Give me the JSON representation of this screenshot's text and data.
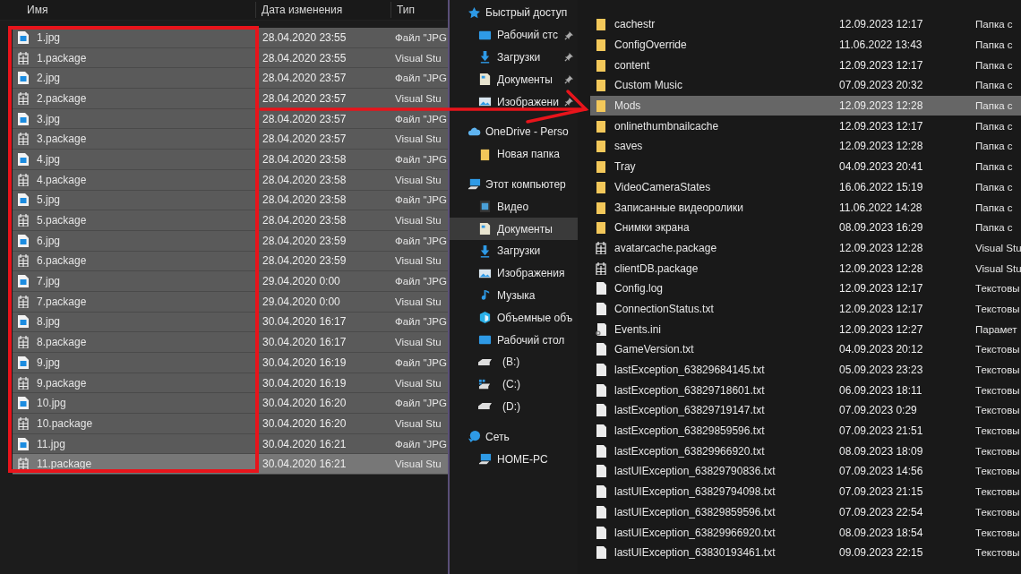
{
  "left_pane": {
    "columns": [
      "Имя",
      "Дата изменения",
      "Тип"
    ],
    "rows": [
      {
        "name": "1.jpg",
        "kind": "image",
        "date": "28.04.2020 23:55",
        "type": "Файл \"JPG",
        "selected": true,
        "hovered": false
      },
      {
        "name": "1.package",
        "kind": "package",
        "date": "28.04.2020 23:55",
        "type": "Visual Stu",
        "selected": true,
        "hovered": false
      },
      {
        "name": "2.jpg",
        "kind": "image",
        "date": "28.04.2020 23:57",
        "type": "Файл \"JPG",
        "selected": true,
        "hovered": false
      },
      {
        "name": "2.package",
        "kind": "package",
        "date": "28.04.2020 23:57",
        "type": "Visual Stu",
        "selected": true,
        "hovered": false
      },
      {
        "name": "3.jpg",
        "kind": "image",
        "date": "28.04.2020 23:57",
        "type": "Файл \"JPG",
        "selected": true,
        "hovered": false
      },
      {
        "name": "3.package",
        "kind": "package",
        "date": "28.04.2020 23:57",
        "type": "Visual Stu",
        "selected": true,
        "hovered": false
      },
      {
        "name": "4.jpg",
        "kind": "image",
        "date": "28.04.2020 23:58",
        "type": "Файл \"JPG",
        "selected": true,
        "hovered": false
      },
      {
        "name": "4.package",
        "kind": "package",
        "date": "28.04.2020 23:58",
        "type": "Visual Stu",
        "selected": true,
        "hovered": false
      },
      {
        "name": "5.jpg",
        "kind": "image",
        "date": "28.04.2020 23:58",
        "type": "Файл \"JPG",
        "selected": true,
        "hovered": false
      },
      {
        "name": "5.package",
        "kind": "package",
        "date": "28.04.2020 23:58",
        "type": "Visual Stu",
        "selected": true,
        "hovered": false
      },
      {
        "name": "6.jpg",
        "kind": "image",
        "date": "28.04.2020 23:59",
        "type": "Файл \"JPG",
        "selected": true,
        "hovered": false
      },
      {
        "name": "6.package",
        "kind": "package",
        "date": "28.04.2020 23:59",
        "type": "Visual Stu",
        "selected": true,
        "hovered": false
      },
      {
        "name": "7.jpg",
        "kind": "image",
        "date": "29.04.2020 0:00",
        "type": "Файл \"JPG",
        "selected": true,
        "hovered": false
      },
      {
        "name": "7.package",
        "kind": "package",
        "date": "29.04.2020 0:00",
        "type": "Visual Stu",
        "selected": true,
        "hovered": false
      },
      {
        "name": "8.jpg",
        "kind": "image",
        "date": "30.04.2020 16:17",
        "type": "Файл \"JPG",
        "selected": true,
        "hovered": false
      },
      {
        "name": "8.package",
        "kind": "package",
        "date": "30.04.2020 16:17",
        "type": "Visual Stu",
        "selected": true,
        "hovered": false
      },
      {
        "name": "9.jpg",
        "kind": "image",
        "date": "30.04.2020 16:19",
        "type": "Файл \"JPG",
        "selected": true,
        "hovered": false
      },
      {
        "name": "9.package",
        "kind": "package",
        "date": "30.04.2020 16:19",
        "type": "Visual Stu",
        "selected": true,
        "hovered": false
      },
      {
        "name": "10.jpg",
        "kind": "image",
        "date": "30.04.2020 16:20",
        "type": "Файл \"JPG",
        "selected": true,
        "hovered": false
      },
      {
        "name": "10.package",
        "kind": "package",
        "date": "30.04.2020 16:20",
        "type": "Visual Stu",
        "selected": true,
        "hovered": false
      },
      {
        "name": "11.jpg",
        "kind": "image",
        "date": "30.04.2020 16:21",
        "type": "Файл \"JPG",
        "selected": true,
        "hovered": false
      },
      {
        "name": "11.package",
        "kind": "package",
        "date": "30.04.2020 16:21",
        "type": "Visual Stu",
        "selected": true,
        "hovered": true
      }
    ]
  },
  "navigation": [
    {
      "label": "Быстрый доступ",
      "kind": "star",
      "selected": false,
      "pinned": false,
      "children": [
        {
          "label": "Рабочий стс",
          "kind": "desktop",
          "selected": false,
          "pinned": true
        },
        {
          "label": "Загрузки",
          "kind": "download",
          "selected": false,
          "pinned": true
        },
        {
          "label": "Документы",
          "kind": "document",
          "selected": false,
          "pinned": true
        },
        {
          "label": "Изображени",
          "kind": "image",
          "selected": false,
          "pinned": true
        }
      ]
    },
    {
      "label": "OneDrive - Perso",
      "kind": "cloud",
      "selected": false,
      "pinned": false,
      "children": [
        {
          "label": "Новая папка",
          "kind": "folder",
          "selected": false,
          "pinned": false
        }
      ]
    },
    {
      "label": "Этот компьютер",
      "kind": "computer",
      "selected": false,
      "pinned": false,
      "children": [
        {
          "label": "Видео",
          "kind": "video",
          "selected": false,
          "pinned": false
        },
        {
          "label": "Документы",
          "kind": "document",
          "selected": true,
          "pinned": false
        },
        {
          "label": "Загрузки",
          "kind": "download",
          "selected": false,
          "pinned": false
        },
        {
          "label": "Изображения",
          "kind": "image",
          "selected": false,
          "pinned": false
        },
        {
          "label": "Музыка",
          "kind": "music",
          "selected": false,
          "pinned": false
        },
        {
          "label": "Объемные объ",
          "kind": "cube",
          "selected": false,
          "pinned": false
        },
        {
          "label": "Рабочий стол",
          "kind": "desktop",
          "selected": false,
          "pinned": false
        },
        {
          "label": "(B:)",
          "kind": "drive",
          "selected": false,
          "pinned": false
        },
        {
          "label": "(C:)",
          "kind": "system-drive",
          "selected": false,
          "pinned": false
        },
        {
          "label": "(D:)",
          "kind": "drive",
          "selected": false,
          "pinned": false
        }
      ]
    },
    {
      "label": "Сеть",
      "kind": "network",
      "selected": false,
      "pinned": false,
      "children": [
        {
          "label": "HOME-PC",
          "kind": "computer",
          "selected": false,
          "pinned": false
        }
      ]
    }
  ],
  "right_pane": {
    "rows": [
      {
        "name": "cachestr",
        "kind": "folder",
        "date": "12.09.2023 12:17",
        "type": "Папка с",
        "selected": false
      },
      {
        "name": "ConfigOverride",
        "kind": "folder",
        "date": "11.06.2022 13:43",
        "type": "Папка с",
        "selected": false
      },
      {
        "name": "content",
        "kind": "folder",
        "date": "12.09.2023 12:17",
        "type": "Папка с",
        "selected": false
      },
      {
        "name": "Custom Music",
        "kind": "folder",
        "date": "07.09.2023 20:32",
        "type": "Папка с",
        "selected": false
      },
      {
        "name": "Mods",
        "kind": "folder",
        "date": "12.09.2023 12:28",
        "type": "Папка с",
        "selected": true
      },
      {
        "name": "onlinethumbnailcache",
        "kind": "folder",
        "date": "12.09.2023 12:17",
        "type": "Папка с",
        "selected": false
      },
      {
        "name": "saves",
        "kind": "folder",
        "date": "12.09.2023 12:28",
        "type": "Папка с",
        "selected": false
      },
      {
        "name": "Tray",
        "kind": "folder",
        "date": "04.09.2023 20:41",
        "type": "Папка с",
        "selected": false
      },
      {
        "name": "VideoCameraStates",
        "kind": "folder",
        "date": "16.06.2022 15:19",
        "type": "Папка с",
        "selected": false
      },
      {
        "name": "Записанные видеоролики",
        "kind": "folder",
        "date": "11.06.2022 14:28",
        "type": "Папка с",
        "selected": false
      },
      {
        "name": "Снимки экрана",
        "kind": "folder",
        "date": "08.09.2023 16:29",
        "type": "Папка с",
        "selected": false
      },
      {
        "name": "avatarcache.package",
        "kind": "package",
        "date": "12.09.2023 12:28",
        "type": "Visual Stu",
        "selected": false
      },
      {
        "name": "clientDB.package",
        "kind": "package",
        "date": "12.09.2023 12:28",
        "type": "Visual Stu",
        "selected": false
      },
      {
        "name": "Config.log",
        "kind": "text",
        "date": "12.09.2023 12:17",
        "type": "Текстовы",
        "selected": false
      },
      {
        "name": "ConnectionStatus.txt",
        "kind": "text",
        "date": "12.09.2023 12:17",
        "type": "Текстовы",
        "selected": false
      },
      {
        "name": "Events.ini",
        "kind": "settings",
        "date": "12.09.2023 12:27",
        "type": "Парамет",
        "selected": false
      },
      {
        "name": "GameVersion.txt",
        "kind": "text",
        "date": "04.09.2023 20:12",
        "type": "Текстовы",
        "selected": false
      },
      {
        "name": "lastException_63829684145.txt",
        "kind": "text",
        "date": "05.09.2023 23:23",
        "type": "Текстовы",
        "selected": false
      },
      {
        "name": "lastException_63829718601.txt",
        "kind": "text",
        "date": "06.09.2023 18:11",
        "type": "Текстовы",
        "selected": false
      },
      {
        "name": "lastException_63829719147.txt",
        "kind": "text",
        "date": "07.09.2023 0:29",
        "type": "Текстовы",
        "selected": false
      },
      {
        "name": "lastException_63829859596.txt",
        "kind": "text",
        "date": "07.09.2023 21:51",
        "type": "Текстовы",
        "selected": false
      },
      {
        "name": "lastException_63829966920.txt",
        "kind": "text",
        "date": "08.09.2023 18:09",
        "type": "Текстовы",
        "selected": false
      },
      {
        "name": "lastUIException_63829790836.txt",
        "kind": "text",
        "date": "07.09.2023 14:56",
        "type": "Текстовы",
        "selected": false
      },
      {
        "name": "lastUIException_63829794098.txt",
        "kind": "text",
        "date": "07.09.2023 21:15",
        "type": "Текстовы",
        "selected": false
      },
      {
        "name": "lastUIException_63829859596.txt",
        "kind": "text",
        "date": "07.09.2023 22:54",
        "type": "Текстовы",
        "selected": false
      },
      {
        "name": "lastUIException_63829966920.txt",
        "kind": "text",
        "date": "08.09.2023 18:54",
        "type": "Текстовы",
        "selected": false
      },
      {
        "name": "lastUIException_63830193461.txt",
        "kind": "text",
        "date": "09.09.2023 22:15",
        "type": "Текстовы",
        "selected": false
      }
    ]
  }
}
